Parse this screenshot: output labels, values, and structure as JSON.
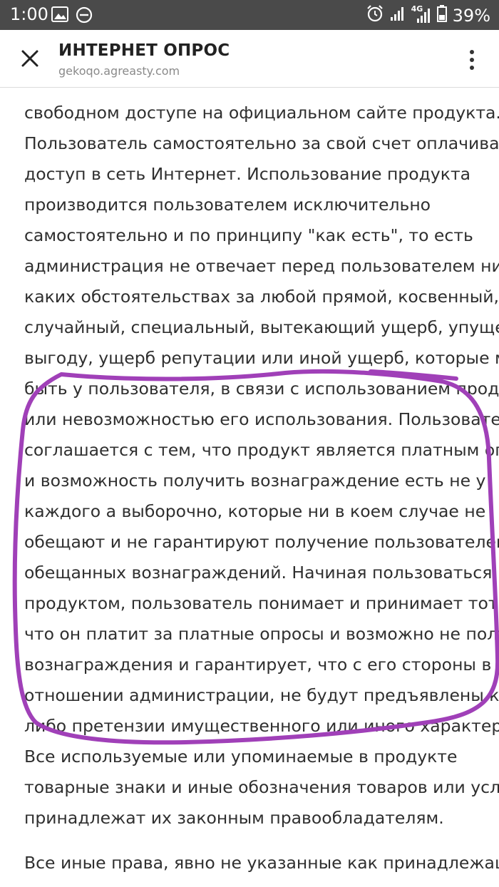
{
  "status_bar": {
    "time": "1:00",
    "network_label": "4G",
    "battery": "39%"
  },
  "header": {
    "title": "ИНТЕРНЕТ ОПРОС",
    "url": "gekoqo.agreasty.com"
  },
  "content": {
    "lines": [
      "свободном доступе на официальном сайте продукта.",
      "Пользователь самостоятельно за свой счет оплачивает",
      "доступ в сеть Интернет. Использование продукта",
      "производится пользователем исключительно",
      "самостоятельно и по принципу \"как есть\", то есть",
      "администрация не отвечает перед пользователем ни при",
      "каких обстоятельствах за любой прямой, косвенный,",
      "случайный, специальный, вытекающий ущерб, упущенную",
      "выгоду, ущерб репутации или иной ущерб, которые могут",
      "быть у пользователя, в связи с использованием продукта",
      "или невозможностью его использования. Пользователь",
      "соглашается с тем, что продукт является платным опросом",
      "и возможность получить вознаграждение есть не у",
      "каждого а выборочно, которые ни в коем случае не",
      "обещают и не гарантируют получение пользователем",
      "обещанных вознаграждений. Начиная пользоваться",
      "продуктом, пользователь понимает и принимает тот факт,",
      "что он платит за платные опросы и возможно не получит",
      "вознаграждения и гарантирует, что с его стороны в",
      "отношении администрации, не будут предъявлены какие-",
      "либо претензии имущественного или иного характера.",
      "Все используемые или упоминаемые в продукте",
      "товарные знаки и иные обозначения товаров или услуг",
      "принадлежат их законным правообладателям.",
      "Все иные права, явно не указанные как принадлежащие"
    ]
  },
  "annotation_color": "#a040b8"
}
